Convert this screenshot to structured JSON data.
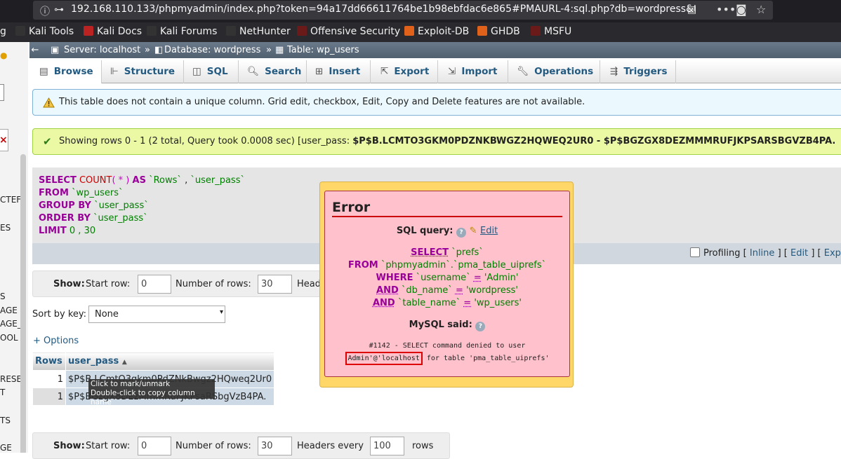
{
  "browser": {
    "url_main": "192.168.110.133/phpmyadmin/index.php?token=94a17dd66611764be1b98ebfdac6e865#PMAURL-4:sql.php?db=wordpress&tal",
    "url_dim": "",
    "bookmarks": [
      "Kali Tools",
      "Kali Docs",
      "Kali Forums",
      "NetHunter",
      "Offensive Security",
      "Exploit-DB",
      "GHDB",
      "MSFU"
    ],
    "bookmark_fragment": "g"
  },
  "sidebar_fragments": [
    "CTEF",
    "ES",
    "S",
    "AGE",
    "AGE_",
    "OOL",
    "RESE",
    "T",
    "TS",
    "GE"
  ],
  "breadcrumb": {
    "server": "Server: localhost",
    "database": "Database: wordpress",
    "table": "Table: wp_users",
    "sep": "»"
  },
  "tabs": [
    "Browse",
    "Structure",
    "SQL",
    "Search",
    "Insert",
    "Export",
    "Import",
    "Operations",
    "Triggers"
  ],
  "notices": {
    "warning": "This table does not contain a unique column. Grid edit, checkbox, Edit, Copy and Delete features are not available.",
    "success_prefix": "Showing rows 0 - 1 (2 total, Query took 0.0008 sec) [user_pass: ",
    "success_bold": "$P$B.LCMTO3GKM0PDZNKBWGZ2HQWEQ2UR0 - $P$BGZGX8DEZMMMRUFJKPSARSBGVZB4PA."
  },
  "sql": {
    "select": "SELECT",
    "count": "COUNT",
    "star": "( * )",
    "as": "AS",
    "rows_alias": "`Rows`",
    "comma": ",",
    "user_pass": "`user_pass`",
    "from": "FROM",
    "table": "`wp_users`",
    "group_by": "GROUP BY",
    "order_by": "ORDER BY",
    "limit": "LIMIT",
    "limit_vals": "0 , 30"
  },
  "profiling": {
    "label": "Profiling [",
    "inline": "Inline",
    "sep": "] [",
    "edit": "Edit",
    "explain": "Exp"
  },
  "nav_top": {
    "show": "Show",
    "start_row": "Start row:",
    "start_val": "0",
    "num_rows": "Number of rows:",
    "num_val": "30",
    "headers": "Head"
  },
  "nav_bottom": {
    "show": "Show",
    "start_row": "Start row:",
    "start_val": "0",
    "num_rows": "Number of rows:",
    "num_val": "30",
    "headers": "Headers every",
    "headers_val": "100",
    "rows": "rows"
  },
  "sort": {
    "label": "Sort by key:",
    "value": "None"
  },
  "options_link": "+ Options",
  "results": {
    "headers": [
      "Rows",
      "user_pass"
    ],
    "rows": [
      [
        "1",
        "$P$B.LCmtO3gkm0PdZNkBwgz2HQweq2Ur0"
      ],
      [
        "1",
        "$P$BGzgX8DEzMmmRuFJKPsaRSbgVzB4PA."
      ]
    ]
  },
  "tooltip": {
    "line1": "Click to mark/unmark",
    "line2": "Double-click to copy column name"
  },
  "error": {
    "title": "Error",
    "sql_query_label": "SQL query:",
    "edit": "Edit",
    "q_select": "SELECT",
    "q_prefs": "`prefs`",
    "q_from": "FROM",
    "q_table": "`phpmyadmin`.`pma_table_uiprefs`",
    "q_where": "WHERE",
    "q_username": "`username`",
    "q_eq": "=",
    "q_admin": "'Admin'",
    "q_and": "AND",
    "q_dbname": "`db_name`",
    "q_wordpress": "'wordpress'",
    "q_tablename": "`table_name`",
    "q_wpusers": "'wp_users'",
    "mysql_said": "MySQL said:",
    "msg_line1": "#1142 - SELECT command denied to user",
    "msg_user": "Admin'@'localhost",
    "msg_rest": "for table 'pma_table_uiprefs'"
  }
}
